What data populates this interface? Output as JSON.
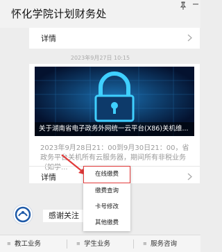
{
  "window": {
    "title": "怀化学院计划财务处"
  },
  "feed": {
    "first_card": {
      "detail_label": "详情"
    },
    "timestamp": "2023年9月27日 10:15",
    "article": {
      "caption": "关于湖南省电子政务外网统一云平台(X86)关机维...",
      "summary": "2023年9月28日21：00到9月30日21：00，省政务平台关机所有云服务器，期间所有非税业务（如学...",
      "detail_label": "详情"
    }
  },
  "popup_menu": {
    "items": [
      "在线缴费",
      "缴费查询",
      "卡号修改",
      "其他缴费"
    ],
    "highlighted": "在线缴费"
  },
  "follow": {
    "label": "感谢关注"
  },
  "tabbar": {
    "tabs": [
      "教工业务",
      "学生业务",
      "服务咨询"
    ]
  },
  "colors": {
    "highlight_border": "#e23a3a",
    "banner_bg": "#05163a",
    "lock_glow": "#3fd0ff"
  }
}
